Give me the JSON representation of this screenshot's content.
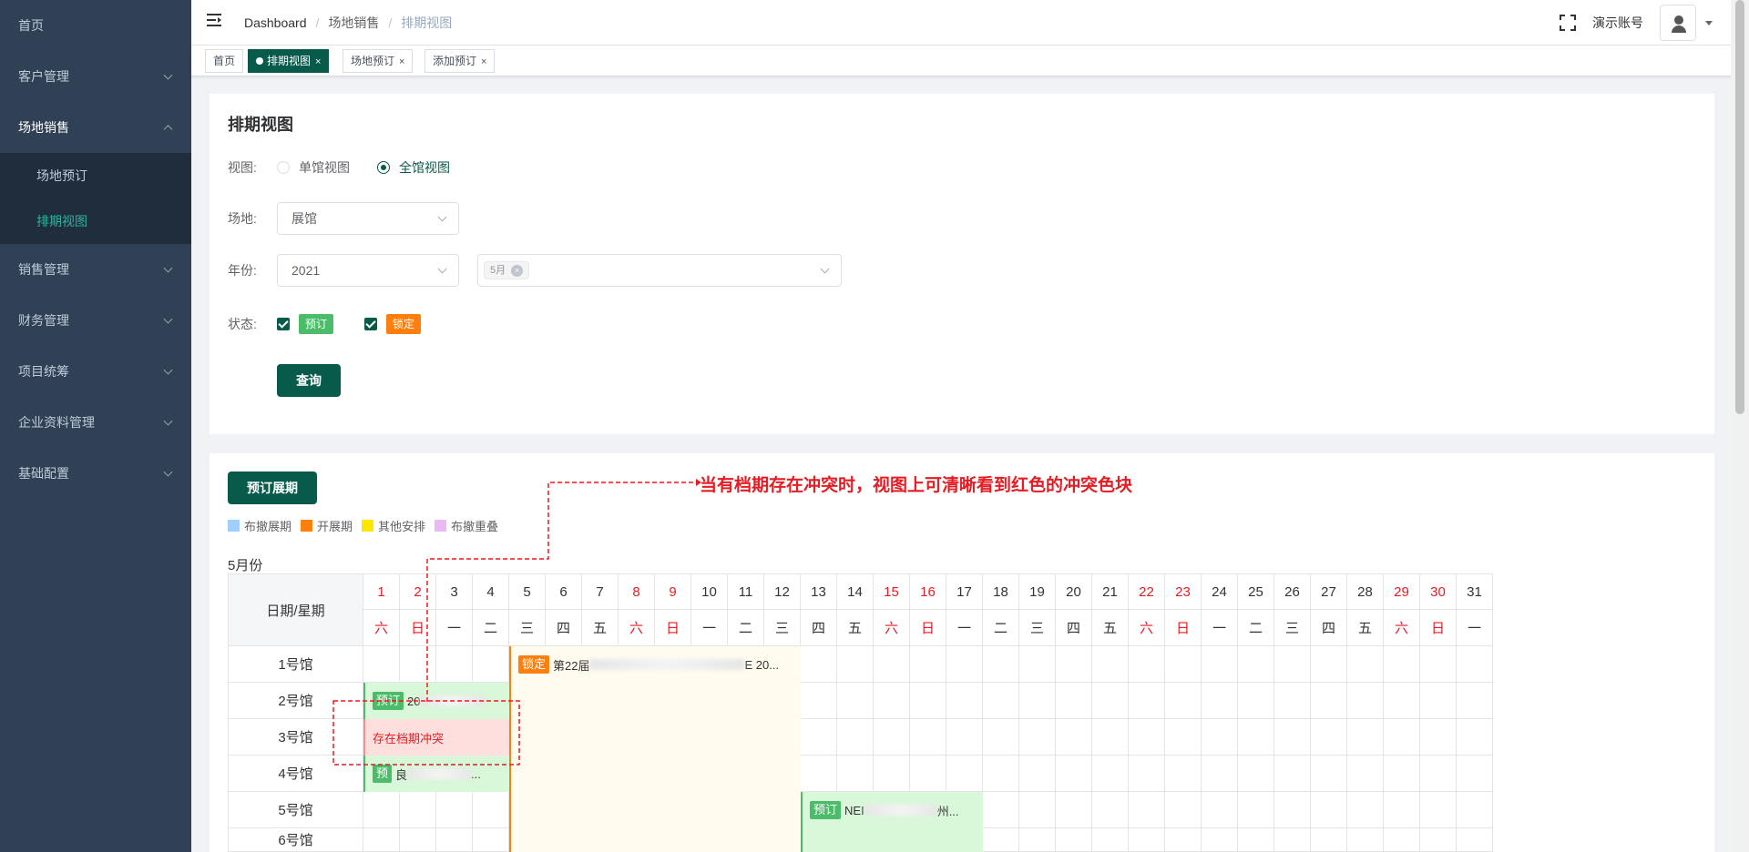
{
  "sidebar": {
    "items": [
      {
        "label": "首页"
      },
      {
        "label": "客户管理"
      },
      {
        "label": "场地销售"
      },
      {
        "label": "销售管理"
      },
      {
        "label": "财务管理"
      },
      {
        "label": "项目统筹"
      },
      {
        "label": "企业资料管理"
      },
      {
        "label": "基础配置"
      }
    ],
    "sub_items": [
      {
        "label": "场地预订"
      },
      {
        "label": "排期视图"
      }
    ]
  },
  "header": {
    "breadcrumb": [
      "Dashboard",
      "场地销售",
      "排期视图"
    ],
    "account": "演示账号"
  },
  "tags": [
    {
      "label": "首页"
    },
    {
      "label": "排期视图"
    },
    {
      "label": "场地预订"
    },
    {
      "label": "添加预订"
    }
  ],
  "filter": {
    "title": "排期视图",
    "view_label": "视图:",
    "view_options": [
      "单馆视图",
      "全馆视图"
    ],
    "view_selected": "全馆视图",
    "venue_label": "场地:",
    "venue_value": "展馆",
    "year_label": "年份:",
    "year_value": "2021",
    "month_tag": "5月",
    "status_label": "状态:",
    "status_tags": [
      "预订",
      "锁定"
    ],
    "query_button": "查询"
  },
  "schedule": {
    "book_button": "预订展期",
    "legend": [
      {
        "label": "布撤展期",
        "color": "#a0cfff"
      },
      {
        "label": "开展期",
        "color": "#ff7f0e"
      },
      {
        "label": "其他安排",
        "color": "#ffe600"
      },
      {
        "label": "布撤重叠",
        "color": "#eab8f2"
      }
    ],
    "month_label": "5月份",
    "corner_label": "日期/星期",
    "days": [
      "1",
      "2",
      "3",
      "4",
      "5",
      "6",
      "7",
      "8",
      "9",
      "10",
      "11",
      "12",
      "13",
      "14",
      "15",
      "16",
      "17",
      "18",
      "19",
      "20",
      "21",
      "22",
      "23",
      "24",
      "25",
      "26",
      "27",
      "28",
      "29",
      "30",
      "31"
    ],
    "weekdays": [
      "六",
      "日",
      "一",
      "二",
      "三",
      "四",
      "五",
      "六",
      "日",
      "一",
      "二",
      "三",
      "四",
      "五",
      "六",
      "日",
      "一",
      "二",
      "三",
      "四",
      "五",
      "六",
      "日",
      "一",
      "二",
      "三",
      "四",
      "五",
      "六",
      "日",
      "一"
    ],
    "halls": [
      "1号馆",
      "2号馆",
      "3号馆",
      "4号馆",
      "5号馆",
      "6号馆"
    ],
    "events": {
      "e1_tag": "锁定",
      "e1_text": "第22届",
      "e1_tail": "E 20...",
      "e2_tag": "预订",
      "e2_text": "20",
      "conflict_text": "存在档期冲突",
      "e4_tag": "预",
      "e4_text": "良",
      "e4_tail": "...",
      "e5_tag": "预订",
      "e5_text": "NEI",
      "e5_tail": "州..."
    },
    "annotation": "当有档期存在冲突时，视图上可清晰看到红色的冲突色块"
  },
  "colors": {
    "sidebar_bg": "#304156",
    "primary": "#085a4b",
    "booked_green": "#4cbc6a",
    "locked_orange": "#ff7f0e",
    "conflict_red": "#e51c23"
  }
}
